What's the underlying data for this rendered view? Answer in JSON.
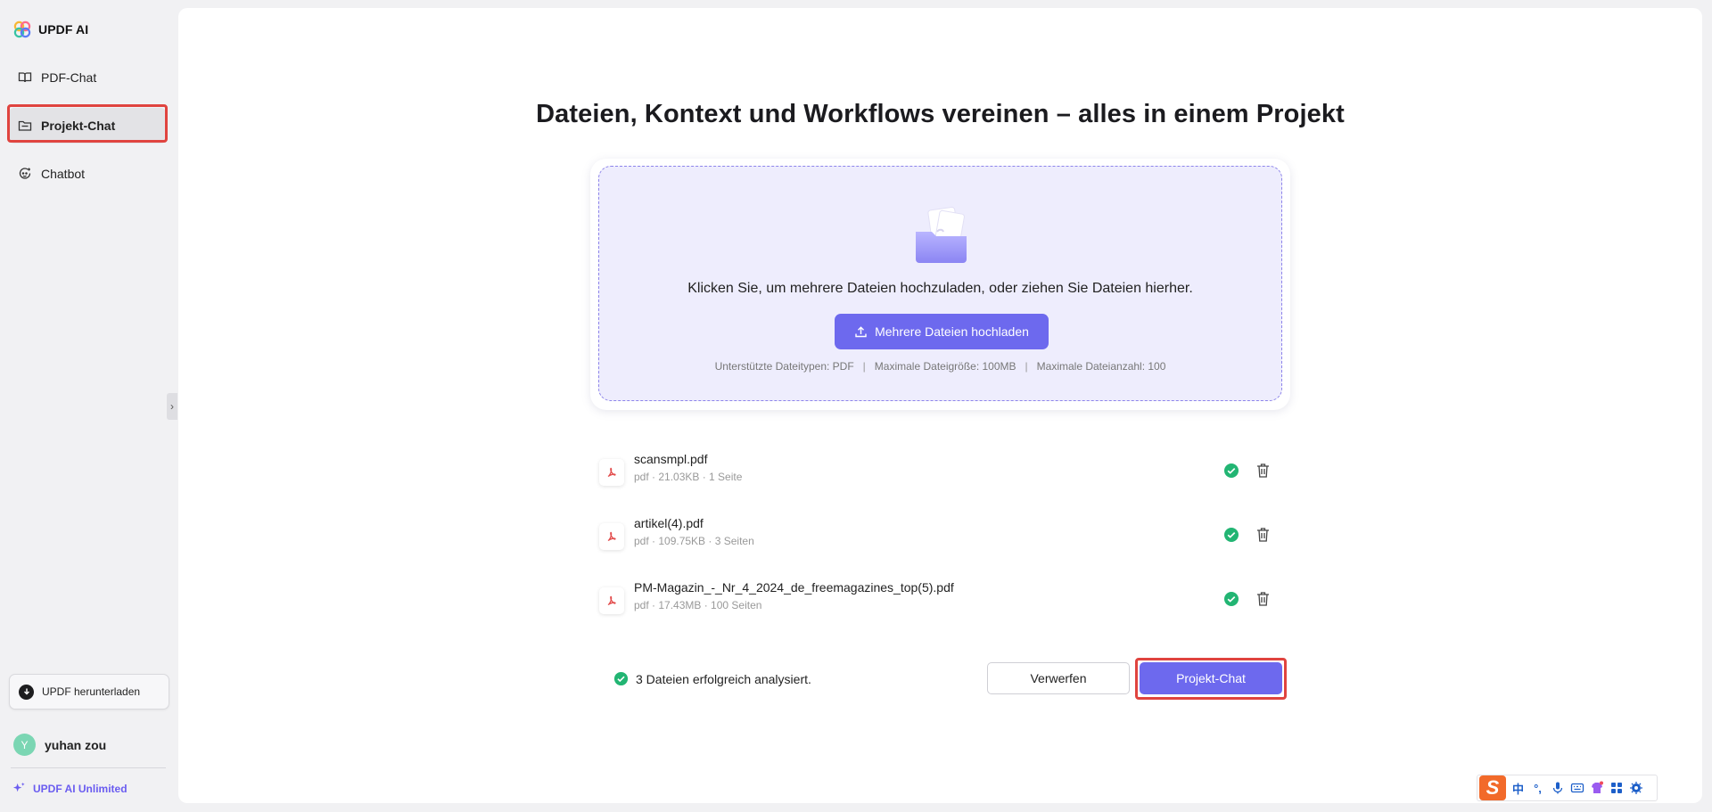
{
  "sidebar": {
    "brand": "UPDF AI",
    "nav": [
      {
        "label": "PDF-Chat"
      },
      {
        "label": "Projekt-Chat"
      },
      {
        "label": "Chatbot"
      }
    ],
    "collapse_glyph": "›",
    "download_label": "UPDF herunterladen",
    "user": {
      "initial": "Y",
      "name": "yuhan zou"
    },
    "plan_label": "UPDF AI Unlimited"
  },
  "main": {
    "title": "Dateien, Kontext und Workflows vereinen – alles in einem Projekt",
    "upload": {
      "instruction": "Klicken Sie, um mehrere Dateien hochzuladen, oder ziehen Sie Dateien hierher.",
      "button_label": "Mehrere Dateien hochladen",
      "limits": [
        "Unterstützte Dateitypen: PDF",
        "Maximale Dateigröße: 100MB",
        "Maximale Dateianzahl: 100"
      ],
      "limits_separator": "|"
    },
    "files": [
      {
        "name": "scansmpl.pdf",
        "meta": "pdf · 21.03KB · 1 Seite"
      },
      {
        "name": "artikel(4).pdf",
        "meta": "pdf · 109.75KB · 3 Seiten"
      },
      {
        "name": "PM-Magazin_-_Nr_4_2024_de_freemagazines_top(5).pdf",
        "meta": "pdf · 17.43MB · 100 Seiten"
      }
    ],
    "status": "3 Dateien erfolgreich analysiert.",
    "discard_label": "Verwerfen",
    "project_chat_label": "Projekt-Chat"
  },
  "ime": {
    "logo": "S",
    "lang": "中",
    "punct": "°,"
  },
  "colors": {
    "accent": "#6d69ee",
    "highlight": "#e0443f",
    "success": "#22b573",
    "pdf_red": "#e24b4b"
  }
}
